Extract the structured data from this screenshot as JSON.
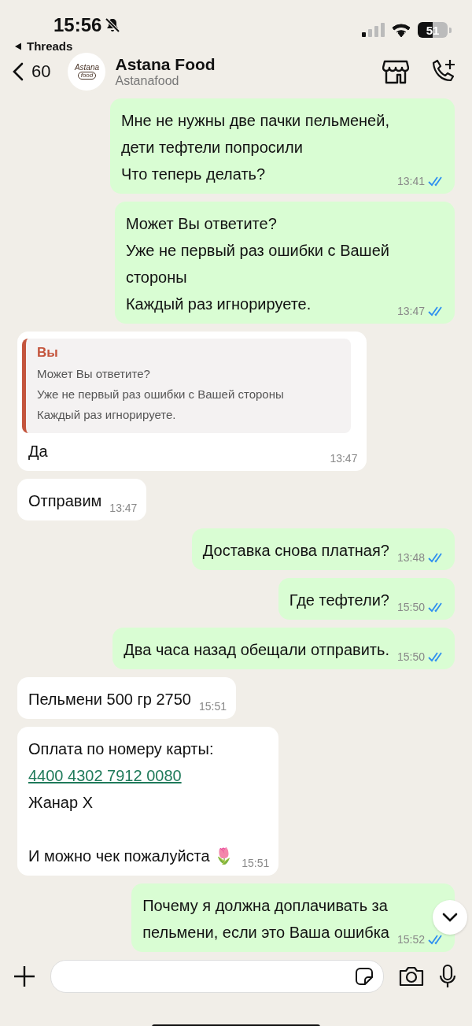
{
  "status_bar": {
    "time": "15:56",
    "muted": true,
    "back_app": "Threads",
    "battery": "51"
  },
  "header": {
    "back_count": "60",
    "avatar": {
      "line_1": "Astana",
      "line_2": "food"
    },
    "title": "Astana Food",
    "subtitle": "Astanafood"
  },
  "messages": [
    {
      "kind": "out",
      "blocks": [
        {
          "text": "Мне не нужны две пачки пельменей,\nдети тефтели попросили\nЧто теперь делать?",
          "link": false
        }
      ],
      "time": "13:41",
      "read": true
    },
    {
      "kind": "out",
      "blocks": [
        {
          "text": "Может Вы ответите?\nУже не первый раз ошибки с Вашей\nстороны\nКаждый раз игнорируете.",
          "link": false
        }
      ],
      "time": "13:47",
      "read": true
    },
    {
      "kind": "in",
      "reply": {
        "author": "Вы",
        "text": "Может Вы ответите?\nУже не первый раз ошибки с Вашей стороны\nКаждый раз игнорируете."
      },
      "blocks": [
        {
          "text": "Да",
          "link": false
        }
      ],
      "time": "13:47"
    },
    {
      "kind": "in",
      "blocks": [
        {
          "text": "Отправим",
          "link": false
        }
      ],
      "time": "13:47"
    },
    {
      "kind": "out",
      "blocks": [
        {
          "text": "Доставка снова платная?",
          "link": false
        }
      ],
      "time": "13:48",
      "read": true
    },
    {
      "kind": "out",
      "blocks": [
        {
          "text": "Где тефтели?",
          "link": false
        }
      ],
      "time": "15:50",
      "read": true
    },
    {
      "kind": "out",
      "blocks": [
        {
          "text": "Два часа назад обещали отправить.",
          "link": false
        }
      ],
      "time": "15:50",
      "read": true
    },
    {
      "kind": "in",
      "blocks": [
        {
          "text": "Пельмени 500 гр 2750",
          "link": false
        }
      ],
      "time": "15:51"
    },
    {
      "kind": "in",
      "blocks": [
        {
          "text": "Оплата по номеру карты:",
          "link": false
        },
        {
          "text": "4400 4302 7912 0080",
          "link": true
        },
        {
          "text": "Жанар Х\n\nИ можно чек пожалуйста 🌷",
          "link": false
        }
      ],
      "time": "15:51"
    },
    {
      "kind": "out",
      "blocks": [
        {
          "text": "Почему я должна доплачивать за\nпельмени, если это Ваша ошибка",
          "link": false
        }
      ],
      "time": "15:52",
      "read": true
    }
  ]
}
